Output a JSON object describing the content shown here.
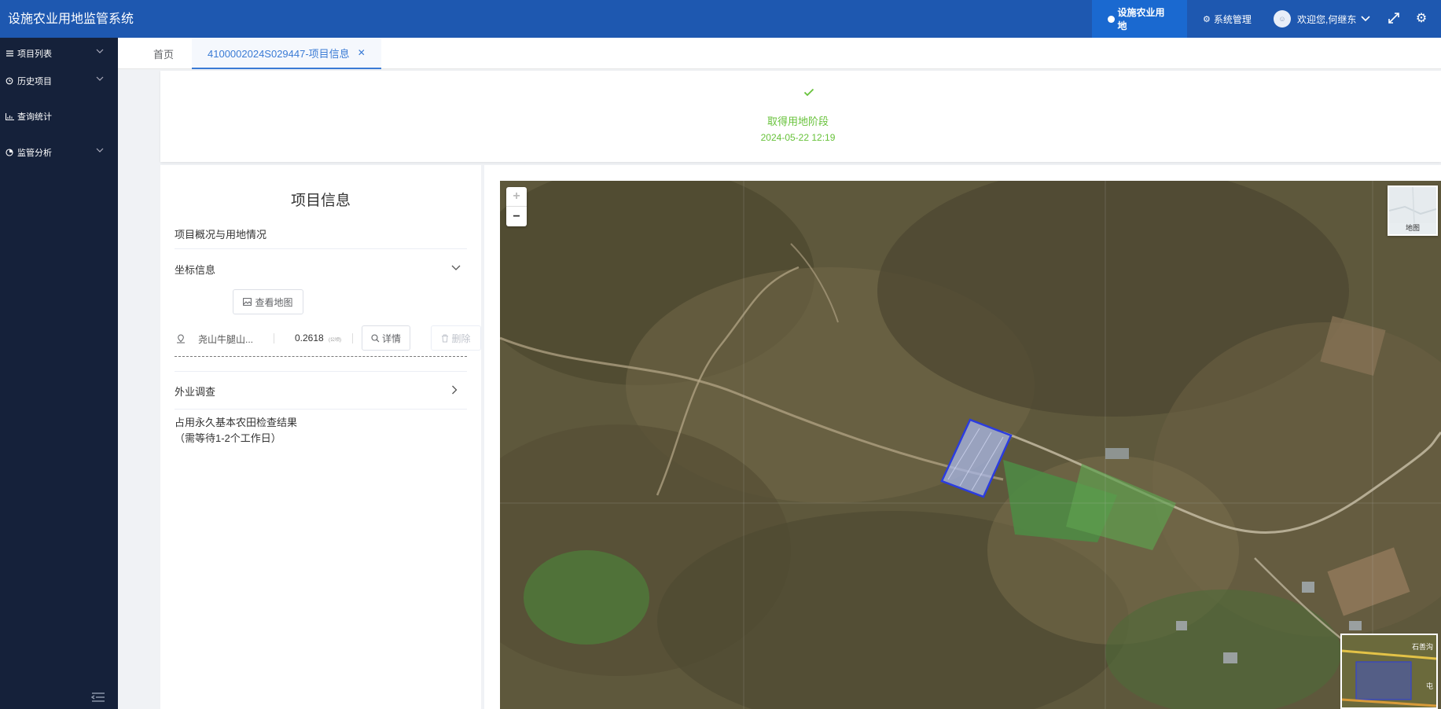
{
  "header": {
    "app_title": "设施农业用地监管系统",
    "nav_facility": "设施农业用地",
    "nav_system": "系统管理",
    "welcome": "欢迎您,何继东"
  },
  "sidebar": {
    "items": [
      {
        "label": "项目列表"
      },
      {
        "label": "历史项目"
      },
      {
        "label": "查询统计"
      },
      {
        "label": "监管分析"
      }
    ]
  },
  "tabs": {
    "home": "首页",
    "active": "4100002024S029447-项目信息"
  },
  "stage": {
    "label": "取得用地阶段",
    "time": "2024-05-22 12:19"
  },
  "info": {
    "title": "项目信息",
    "overview": "项目概况与用地情况",
    "coord_info": "坐标信息",
    "view_map": "查看地图",
    "coord_name": "尧山牛腿山...",
    "coord_area": "0.2618",
    "coord_unit": "(公顷)",
    "detail_btn": "详情",
    "delete_btn": "删除",
    "field_survey": "外业调查",
    "result_line1": "占用永久基本农田检查结果",
    "result_line2": "（需等待1-2个工作日）"
  },
  "map": {
    "zoom_in": "+",
    "zoom_out": "−",
    "layer_label": "地图",
    "overview_place1": "石善沟",
    "overview_place2": "屯"
  }
}
